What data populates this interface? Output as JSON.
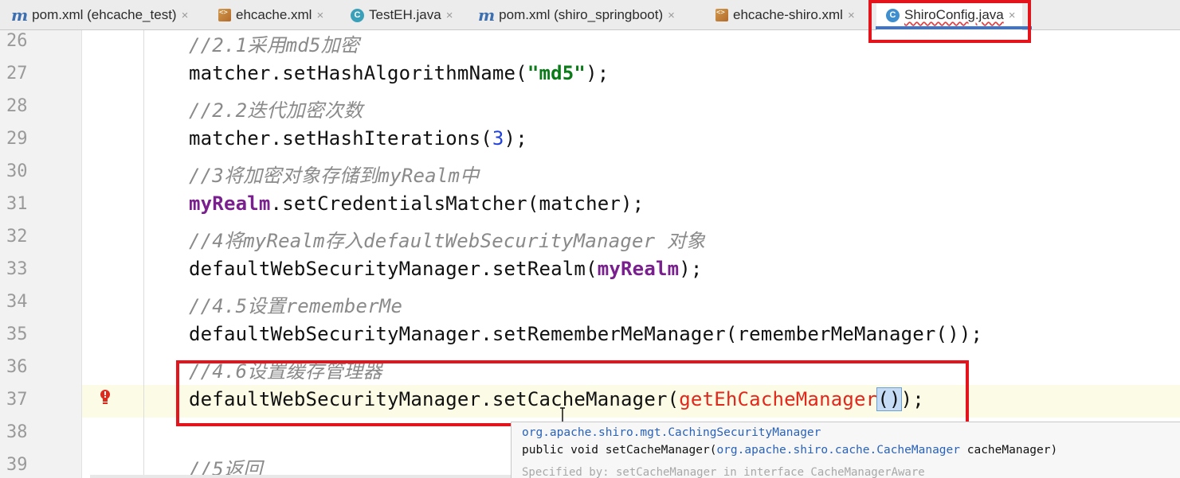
{
  "tabs": [
    {
      "label": "pom.xml (ehcache_test)",
      "icon": "maven-m-icon"
    },
    {
      "label": "ehcache.xml",
      "icon": "xml-file-icon"
    },
    {
      "label": "TestEH.java",
      "icon": "java-class-icon"
    },
    {
      "label": "pom.xml (shiro_springboot)",
      "icon": "maven-m-icon"
    },
    {
      "label": "ehcache-shiro.xml",
      "icon": "xml-file-icon"
    },
    {
      "label": "ShiroConfig.java",
      "icon": "java-class-icon",
      "active": true
    }
  ],
  "close_glyph": "×",
  "lines": [
    {
      "no": "26",
      "code": "//2.1采用md5加密"
    },
    {
      "no": "27",
      "code": "matcher.setHashAlgorithmName(\"md5\");"
    },
    {
      "no": "28",
      "code": "//2.2迭代加密次数"
    },
    {
      "no": "29",
      "code": "matcher.setHashIterations(3);"
    },
    {
      "no": "30",
      "code": "//3将加密对象存储到myRealm中"
    },
    {
      "no": "31",
      "code": "myRealm.setCredentialsMatcher(matcher);"
    },
    {
      "no": "32",
      "code": "//4将myRealm存入defaultWebSecurityManager 对象"
    },
    {
      "no": "33",
      "code": "defaultWebSecurityManager.setRealm(myRealm);"
    },
    {
      "no": "34",
      "code": "//4.5设置rememberMe"
    },
    {
      "no": "35",
      "code": "defaultWebSecurityManager.setRememberMeManager(rememberMeManager());"
    },
    {
      "no": "36",
      "code": "//4.6设置缓存管理器"
    },
    {
      "no": "37",
      "code": "defaultWebSecurityManager.setCacheManager(getEhCacheManager());"
    },
    {
      "no": "38",
      "code": ""
    },
    {
      "no": "39",
      "code": "//5返回"
    }
  ],
  "tokens": {
    "l27_a": "matcher.setHashAlgorithmName(",
    "l27_str": "\"md5\"",
    "l27_b": ");",
    "l29_a": "matcher.setHashIterations(",
    "l29_num": "3",
    "l29_b": ");",
    "l31_fld": "myRealm",
    "l31_b": ".setCredentialsMatcher(matcher);",
    "l33_a": "defaultWebSecurityManager.setRealm(",
    "l33_fld": "myRealm",
    "l33_b": ");",
    "l37_a": "defaultWebSecurityManager.setCacheManager(",
    "l37_err": "getEhCacheManager",
    "l37_paren": "()",
    "l37_b": ");"
  },
  "tooltip": {
    "owner": "org.apache.shiro.mgt.CachingSecurityManager",
    "sig_kw": "public void ",
    "sig_method": "setCacheManager(",
    "sig_type": "org.apache.shiro.cache.CacheManager",
    "sig_param": " cacheManager)",
    "faded": "Specified by: setCacheManager in interface CacheManagerAware"
  },
  "colors": {
    "highlight_box": "#e3141c",
    "active_tab_underline": "#3f74c8",
    "error_text": "#e0281c",
    "comment": "#8a8a8a",
    "string": "#0b7a18",
    "field": "#7a1f8e"
  }
}
